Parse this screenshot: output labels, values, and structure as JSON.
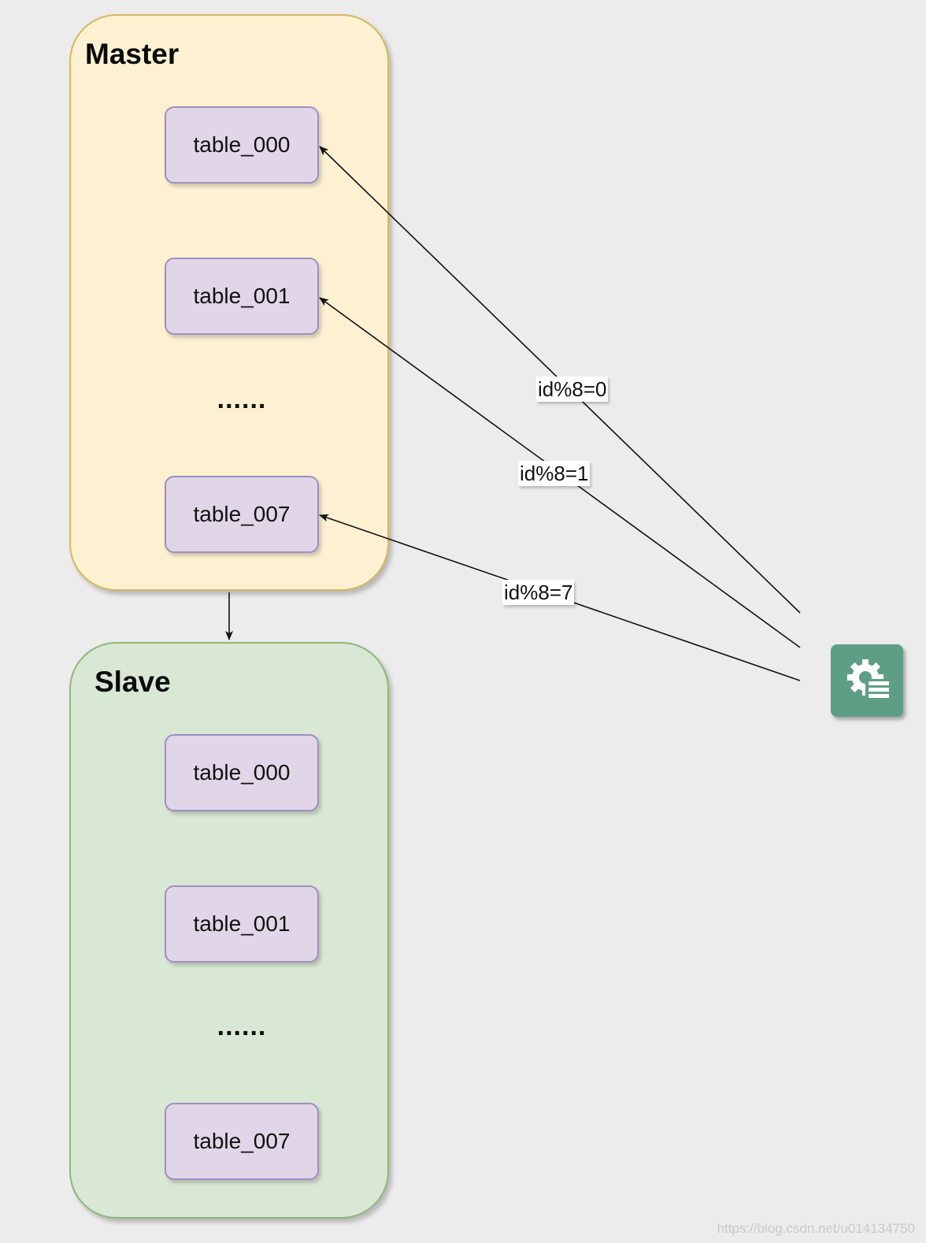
{
  "master": {
    "title": "Master",
    "tables": [
      "table_000",
      "table_001",
      "table_007"
    ],
    "ellipsis": "......"
  },
  "slave": {
    "title": "Slave",
    "tables": [
      "table_000",
      "table_001",
      "table_007"
    ],
    "ellipsis": "......"
  },
  "edges": {
    "route_0": "id%8=0",
    "route_1": "id%8=1",
    "route_7": "id%8=7"
  },
  "service_node": {
    "icon": "gear-list-icon",
    "color": "#5e9e85"
  },
  "colors": {
    "master_fill": "#fdf1d2",
    "master_border": "#d8b85f",
    "slave_fill": "#d9e7d5",
    "slave_border": "#8fb878",
    "table_fill": "#e1d6e8",
    "table_border": "#9f8fbf"
  },
  "watermark": "https://blog.csdn.net/u014134750"
}
